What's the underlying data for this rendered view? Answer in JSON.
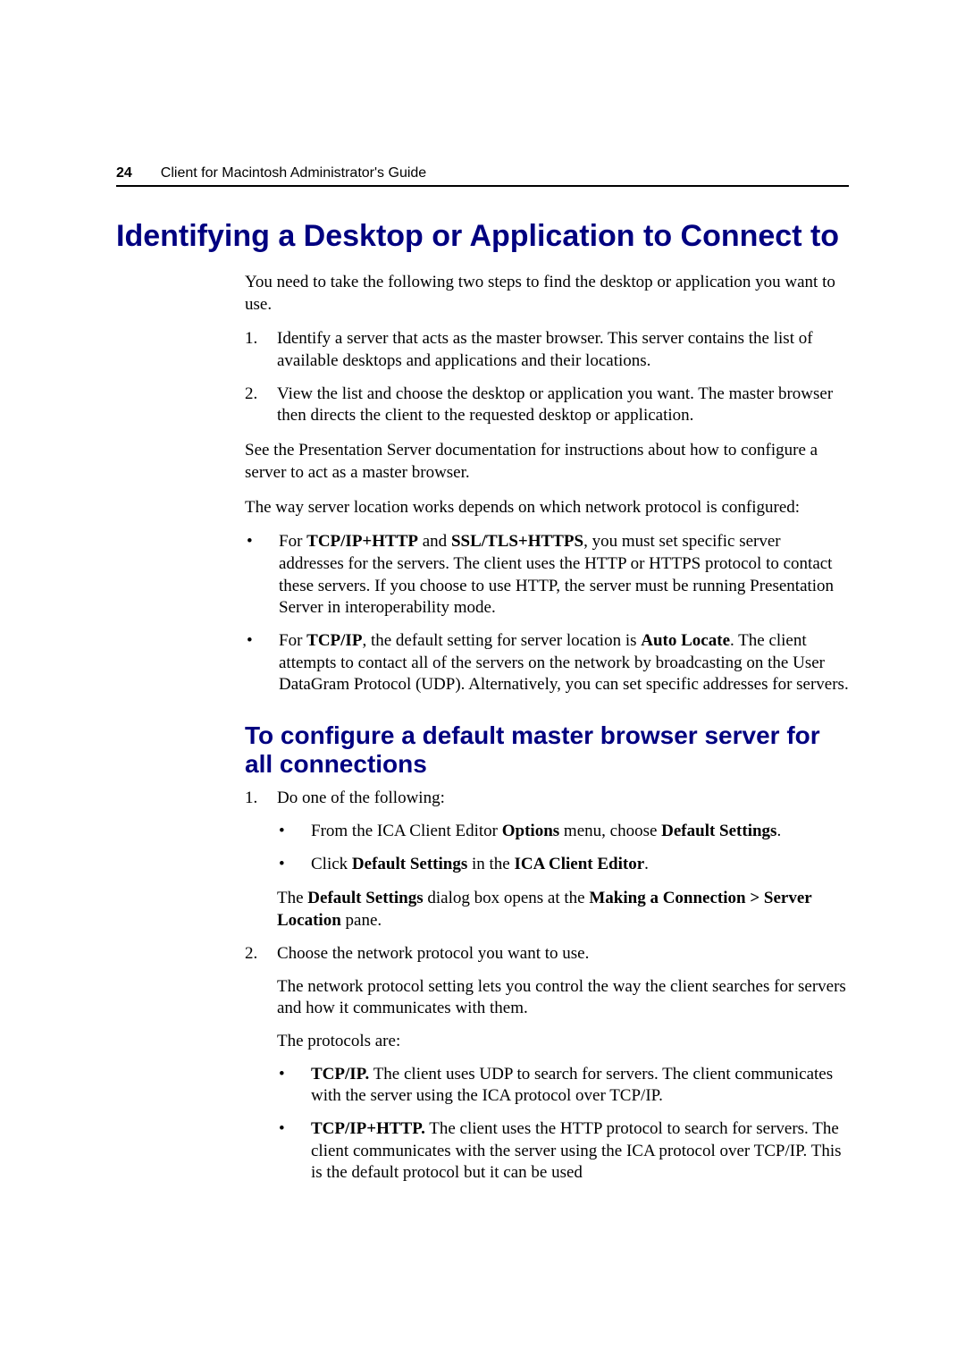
{
  "header": {
    "page_number": "24",
    "title": "Client for Macintosh Administrator's Guide"
  },
  "h1": "Identifying a Desktop or Application to Connect to",
  "intro": "You need to take the following two steps to find the desktop or application you want to use.",
  "steps_a": {
    "n1": "1.",
    "t1": "Identify a server that acts as the master browser. This server contains the list of available desktops and applications and their locations.",
    "n2": "2.",
    "t2": "View the list and choose the desktop or application you want. The master browser then directs the client to the requested desktop or application."
  },
  "para_a": "See the Presentation Server documentation for instructions about how to configure a server to act as a master browser.",
  "para_b": "The way server location works depends on which network protocol is configured:",
  "bullets_a": {
    "b1_pre": "For ",
    "b1_bold1": "TCP/IP+HTTP",
    "b1_mid": " and ",
    "b1_bold2": "SSL/TLS+HTTPS",
    "b1_post": ", you must set specific server addresses for the servers. The client uses the HTTP or HTTPS protocol to contact these servers. If you choose to use HTTP, the server must be running Presentation Server in interoperability mode.",
    "b2_pre": "For ",
    "b2_bold1": "TCP/IP",
    "b2_mid": ", the default setting for server location is ",
    "b2_bold2": "Auto Locate",
    "b2_post": ". The client attempts to contact all of the servers on the network by broadcasting on the User DataGram Protocol (UDP). Alternatively, you can set specific addresses for servers."
  },
  "h2": "To configure a default master browser server for all connections",
  "steps_b": {
    "n1": "1.",
    "t1": "Do one of the following:",
    "sub1a_pre": "From the ICA Client Editor ",
    "sub1a_bold1": "Options",
    "sub1a_mid": " menu, choose ",
    "sub1a_bold2": "Default Settings",
    "sub1a_post": ".",
    "sub1b_pre": "Click ",
    "sub1b_bold1": "Default Settings",
    "sub1b_mid": " in the ",
    "sub1b_bold2": "ICA Client Editor",
    "sub1b_post": ".",
    "result1_pre": "The ",
    "result1_bold1": "Default Settings",
    "result1_mid": " dialog box opens at the ",
    "result1_bold2": "Making a Connection > Server Location",
    "result1_post": " pane.",
    "n2": "2.",
    "t2": "Choose the network protocol you want to use.",
    "p2a": "The network protocol setting lets you control the way the client searches for servers and how it communicates with them.",
    "p2b": "The protocols are:",
    "proto1_bold": "TCP/IP.",
    "proto1_text": " The client uses UDP to search for servers. The client communicates with the server using the ICA protocol over TCP/IP.",
    "proto2_bold": "TCP/IP+HTTP.",
    "proto2_text": " The client uses the HTTP protocol to search for servers. The client communicates with the server using the ICA protocol over TCP/IP. This is the default protocol but it can be used"
  },
  "glyphs": {
    "bullet": "•"
  }
}
